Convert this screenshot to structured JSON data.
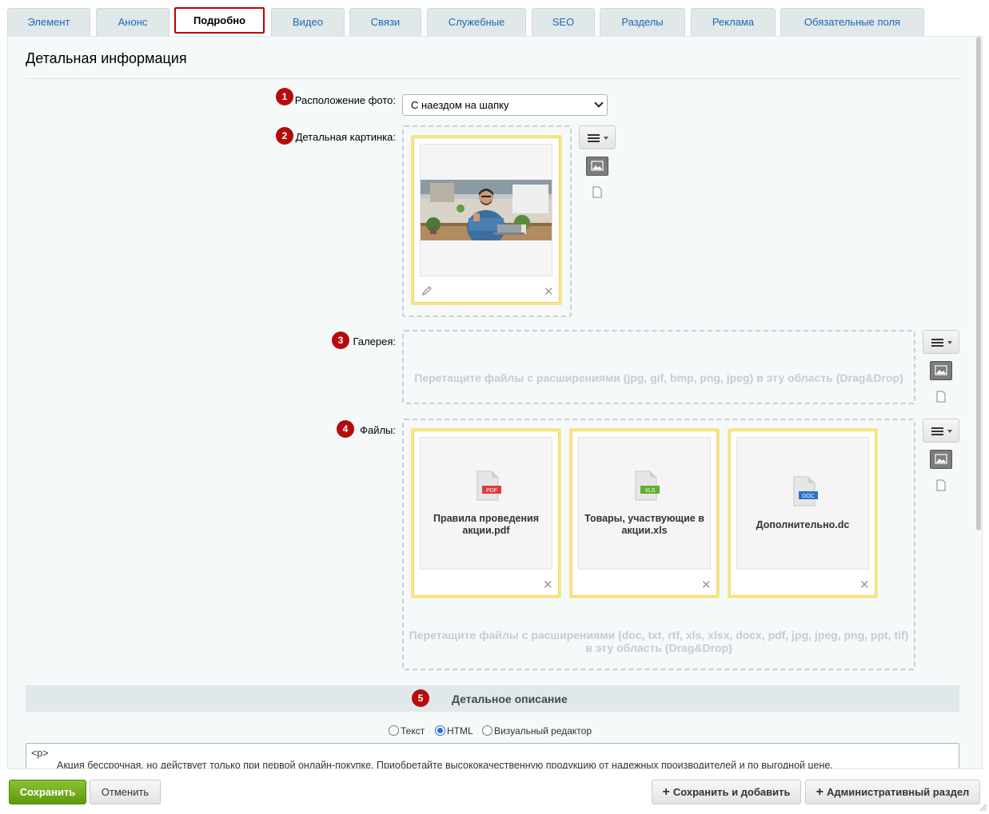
{
  "tabs": [
    {
      "label": "Элемент"
    },
    {
      "label": "Анонс"
    },
    {
      "label": "Подробно"
    },
    {
      "label": "Видео"
    },
    {
      "label": "Связи"
    },
    {
      "label": "Служебные"
    },
    {
      "label": "SEO"
    },
    {
      "label": "Разделы"
    },
    {
      "label": "Реклама"
    },
    {
      "label": "Обязательные поля"
    }
  ],
  "section": {
    "title": "Детальная информация"
  },
  "fields": {
    "photo_position": {
      "badge": "1",
      "label": "Расположение фото:",
      "value": "С наездом на шапку"
    },
    "detail_picture": {
      "badge": "2",
      "label": "Детальная картинка:"
    },
    "gallery": {
      "badge": "3",
      "label": "Галерея:",
      "dropzone_text": "Перетащите файлы с расширениями (jpg, gif, bmp, png, jpeg) в эту область (Drag&Drop)"
    },
    "files": {
      "badge": "4",
      "label": "Файлы:",
      "items": [
        {
          "name": "Правила проведения акции.pdf",
          "type": "PDF",
          "color": "#e0383e"
        },
        {
          "name": "Товары, участвующие в акции.xls",
          "type": "XLS",
          "color": "#5fae2e"
        },
        {
          "name": "Дополнительно.dc",
          "type": "DOC",
          "color": "#2a73c9"
        }
      ],
      "dropzone_text": "Перетащите файлы с расширениями (doc, txt, rtf, xls, xlsx, docx, pdf, jpg, jpeg, png, ppt, tif) в эту область (Drag&Drop)"
    }
  },
  "description": {
    "badge": "5",
    "title": "Детальное описание",
    "modes": {
      "text": "Текст",
      "html": "HTML",
      "visual": "Визуальный редактор"
    },
    "selected_mode": "HTML",
    "content_line1": "<p>",
    "content_line2": "Акция бессрочная, но действует только при первой онлайн-покупке. Приобретайте высококачественную продукцию от надежных производителей и по выгодной цене."
  },
  "buttons": {
    "save": "Сохранить",
    "cancel": "Отменить",
    "save_add": "Сохранить и добавить",
    "admin_section": "Административный раздел"
  },
  "colors": {
    "accent_red": "#b40c0c",
    "save_green": "#6aa71a",
    "card_border": "#f7e58a",
    "link_blue": "#2067b0"
  }
}
